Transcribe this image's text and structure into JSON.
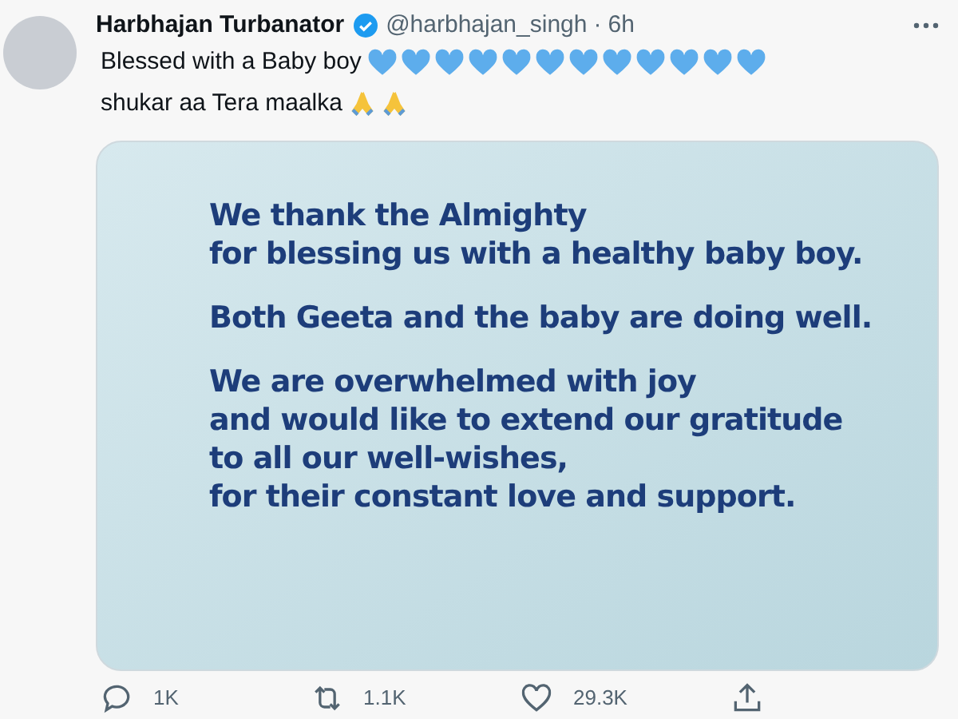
{
  "tweet": {
    "author": "Harbhajan Turbanator",
    "verified": true,
    "handle": "@harbhajan_singh",
    "separator": "·",
    "time": "6h",
    "body": [
      {
        "kind": "text",
        "text": "Blessed with a Baby boy"
      },
      {
        "kind": "heart"
      },
      {
        "kind": "heart"
      },
      {
        "kind": "heart"
      },
      {
        "kind": "heart"
      },
      {
        "kind": "heart"
      },
      {
        "kind": "heart"
      },
      {
        "kind": "heart"
      },
      {
        "kind": "heart"
      },
      {
        "kind": "heart"
      },
      {
        "kind": "heart"
      },
      {
        "kind": "heart"
      },
      {
        "kind": "heart"
      },
      {
        "kind": "text",
        "text": "shukar aa Tera maalka"
      },
      {
        "kind": "pray"
      },
      {
        "kind": "pray"
      }
    ],
    "image": {
      "paragraphs": [
        [
          "We thank the Almighty",
          "for blessing us with a healthy baby boy."
        ],
        [
          "Both Geeta and the baby are doing well."
        ],
        [
          "We are overwhelmed with joy",
          "and would like to extend our gratitude",
          "to all our well-wishes,",
          "for their constant love and support."
        ]
      ]
    },
    "actions": [
      {
        "kind": "reply",
        "count": "1K"
      },
      {
        "kind": "retweet",
        "count": "1.1K"
      },
      {
        "kind": "like",
        "count": "29.3K"
      },
      {
        "kind": "share"
      }
    ]
  }
}
